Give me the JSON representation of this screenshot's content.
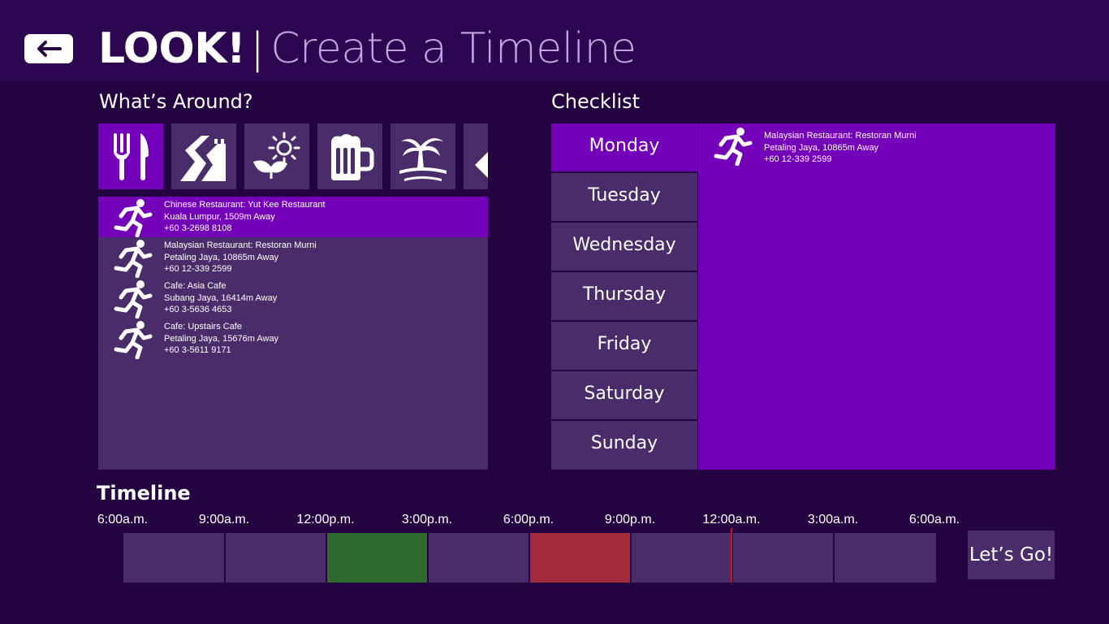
{
  "app": {
    "name": "LOOK!",
    "separator": "|",
    "page_title": "Create a Timeline"
  },
  "colors": {
    "background": "#230440",
    "header": "#2c0650",
    "panel": "#4a2c6a",
    "accent": "#7300b8",
    "green_slot": "#2e6a2e",
    "red_slot": "#a32a3a",
    "now_marker": "#d01030"
  },
  "around": {
    "title": "What’s Around?",
    "categories": [
      {
        "icon": "fork-knife-icon",
        "selected": true
      },
      {
        "icon": "winding-road-icon",
        "selected": false
      },
      {
        "icon": "sun-plant-icon",
        "selected": false
      },
      {
        "icon": "beer-mug-icon",
        "selected": false
      },
      {
        "icon": "palm-island-icon",
        "selected": false
      },
      {
        "icon": "tag-icon",
        "selected": false
      }
    ],
    "places": [
      {
        "name": "Chinese Restaurant: Yut Kee Restaurant",
        "location": "Kuala Lumpur, 1509m Away",
        "phone": "+60 3-2698 8108",
        "icon": "running-person-icon",
        "selected": true
      },
      {
        "name": "Malaysian Restaurant: Restoran Murni",
        "location": "Petaling Jaya, 10865m Away",
        "phone": "+60 12-339 2599",
        "icon": "running-person-icon",
        "selected": false
      },
      {
        "name": "Cafe: Asia Cafe",
        "location": "Subang Jaya, 16414m Away",
        "phone": "+60 3-5636 4653",
        "icon": "running-person-icon",
        "selected": false
      },
      {
        "name": "Cafe: Upstairs Cafe",
        "location": "Petaling Jaya, 15676m Away",
        "phone": "+60 3-5611 9171",
        "icon": "running-person-icon",
        "selected": false
      }
    ]
  },
  "checklist": {
    "title": "Checklist",
    "days": [
      "Monday",
      "Tuesday",
      "Wednesday",
      "Thursday",
      "Friday",
      "Saturday",
      "Sunday"
    ],
    "selected_day": "Monday",
    "items": [
      {
        "name": "Malaysian Restaurant: Restoran Murni",
        "location": "Petaling Jaya, 10865m Away",
        "phone": "+60 12-339 2599",
        "icon": "running-person-icon"
      }
    ]
  },
  "timeline": {
    "title": "Timeline",
    "ticks": [
      "6:00a.m.",
      "9:00a.m.",
      "12:00p.m.",
      "3:00p.m.",
      "6:00p.m.",
      "9:00p.m.",
      "12:00a.m.",
      "3:00a.m.",
      "6:00a.m."
    ],
    "slots": [
      "empty",
      "empty",
      "green",
      "empty",
      "red",
      "empty",
      "empty",
      "empty"
    ],
    "lets_go_label": "Let’s Go!"
  }
}
